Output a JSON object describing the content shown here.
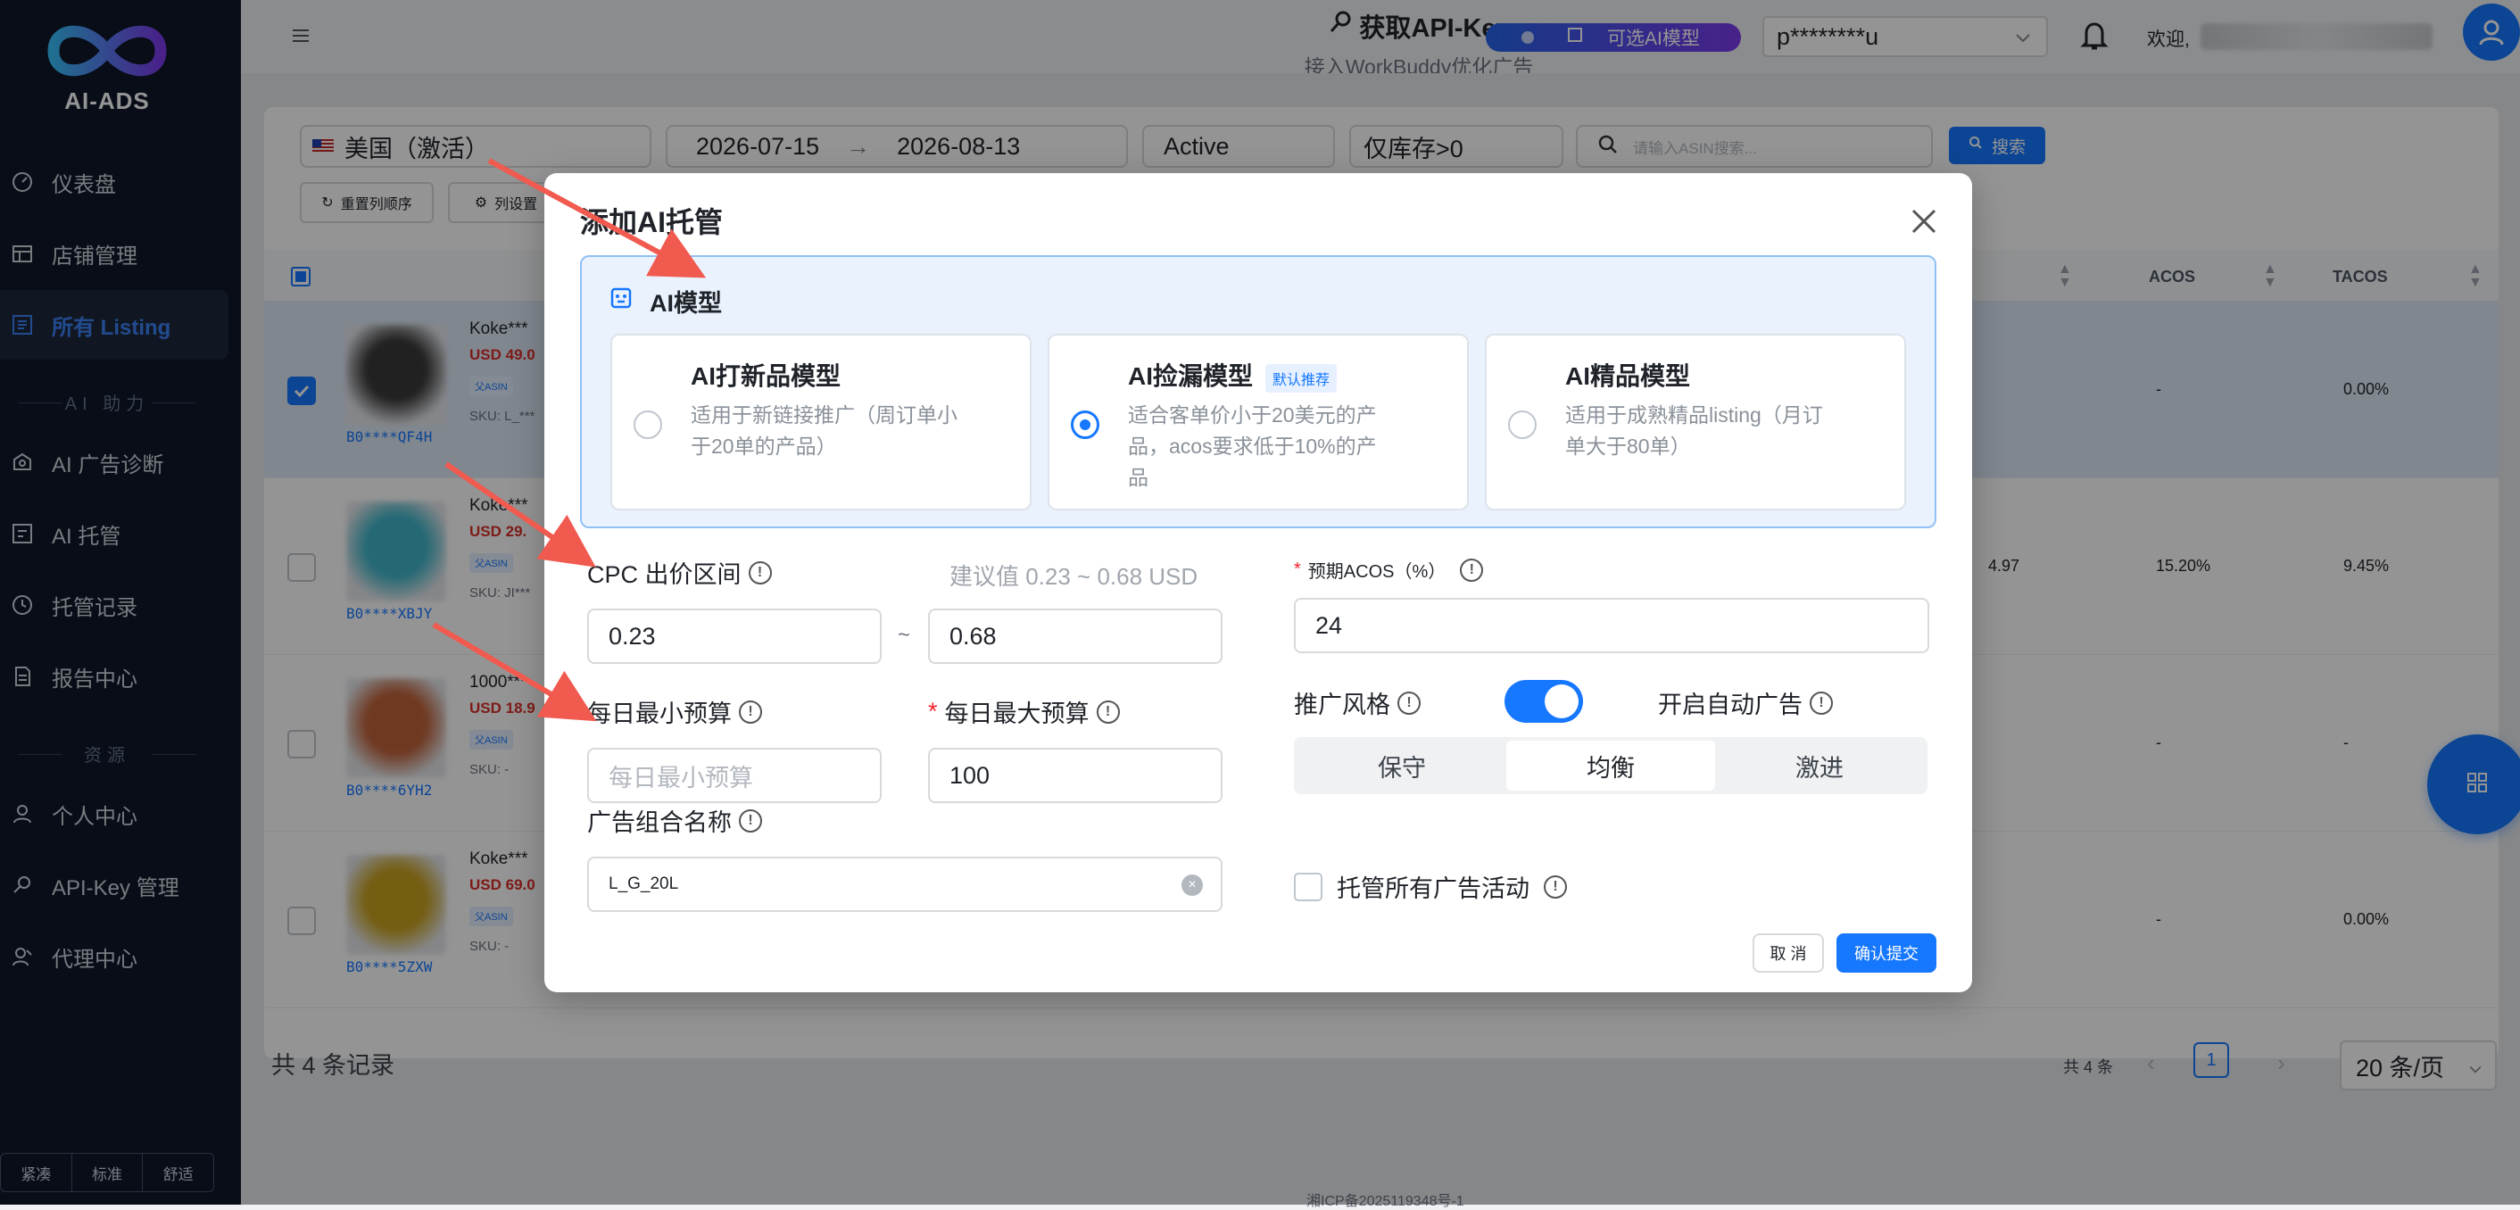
{
  "sidebar": {
    "logo_text": "AI-ADS",
    "items": [
      {
        "label": "仪表盘",
        "icon": "dashboard-icon"
      },
      {
        "label": "店铺管理",
        "icon": "store-icon"
      },
      {
        "label": "所有 Listing",
        "icon": "list-icon",
        "active": true
      },
      {
        "label": "AI 广告诊断",
        "icon": "diagnosis-icon"
      },
      {
        "label": "AI 托管",
        "icon": "managed-icon"
      },
      {
        "label": "托管记录",
        "icon": "history-icon"
      },
      {
        "label": "报告中心",
        "icon": "report-icon"
      },
      {
        "label": "个人中心",
        "icon": "user-icon"
      },
      {
        "label": "API-Key 管理",
        "icon": "key-icon"
      },
      {
        "label": "代理中心",
        "icon": "agent-icon"
      }
    ],
    "sections": {
      "ai_help": "AI 助力",
      "resources": "资源"
    },
    "density": [
      "紧凑",
      "标准",
      "舒适"
    ]
  },
  "header": {
    "title": "获取API-Key",
    "subtitle": "接入WorkBuddy优化广告",
    "ai_model_pill": "可选AI模型",
    "account_select": "p********u",
    "welcome": "欢迎,"
  },
  "filters": {
    "marketplace": "美国（激活）",
    "date_start": "2026-07-15",
    "date_end": "2026-08-13",
    "status": "Active",
    "stock": "仅库存>0",
    "search_placeholder": "请输入ASIN搜索...",
    "search_button": "搜索",
    "reset_order": "重置列顺序",
    "column_settings": "列设置"
  },
  "table": {
    "headers": {
      "acos": "ACOS",
      "tacos": "TACOS"
    },
    "rows": [
      {
        "name": "Koke***",
        "price": "USD 49.0",
        "asin": "B0****QF4H",
        "sku": "SKU: L_***",
        "extra": "",
        "acos": "-",
        "tacos": "0.00%",
        "checked": true,
        "thumb": "#3a3a3a"
      },
      {
        "name": "Koke***",
        "price": "USD 29.",
        "asin": "B0****XBJY",
        "sku": "SKU: JI***",
        "extra": "4.97",
        "acos": "15.20%",
        "tacos": "9.45%",
        "checked": false,
        "thumb": "#3fb5c9"
      },
      {
        "name": "1000***",
        "price": "USD 18.9",
        "asin": "B0****6YH2",
        "sku": "SKU: -",
        "extra": "",
        "acos": "-",
        "tacos": "-",
        "checked": false,
        "thumb": "#c0623a"
      },
      {
        "name": "Koke***",
        "price": "USD 69.0",
        "asin": "B0****5ZXW",
        "sku": "SKU: -",
        "extra": "",
        "acos": "-",
        "tacos": "0.00%",
        "checked": false,
        "thumb": "#c9a21f"
      }
    ],
    "asin_tag": "父ASIN",
    "total_records": "共 4 条记录",
    "pager_total": "共 4 条",
    "page": "1",
    "page_size": "20 条/页"
  },
  "footer_text": "湘ICP备2025119348号-1",
  "modal": {
    "title": "添加AI托管",
    "model_section": "AI模型",
    "models": [
      {
        "title": "AI打新品模型",
        "desc": "适用于新链接推广（周订单小于20单的产品）",
        "selected": false
      },
      {
        "title": "AI捡漏模型",
        "badge": "默认推荐",
        "desc": "适合客单价小于20美元的产品，acos要求低于10%的产品",
        "selected": true
      },
      {
        "title": "AI精品模型",
        "desc": "适用于成熟精品listing（月订单大于80单）",
        "selected": false
      }
    ],
    "cpc_label": "CPC 出价区间",
    "cpc_hint": "建议值 0.23 ~ 0.68 USD",
    "cpc_min": "0.23",
    "cpc_sep": "~",
    "cpc_max": "0.68",
    "acos_label": "预期ACOS（%）",
    "acos_value": "24",
    "min_budget_label": "每日最小预算",
    "min_budget_placeholder": "每日最小预算",
    "max_budget_label": "每日最大预算",
    "max_budget_value": "100",
    "style_label": "推广风格",
    "auto_ad_label": "开启自动广告",
    "style_options": [
      "保守",
      "均衡",
      "激进"
    ],
    "style_selected": 1,
    "adgroup_label": "广告组合名称",
    "adgroup_value": "L_G_20L",
    "manage_all_label": "托管所有广告活动",
    "cancel": "取 消",
    "submit": "确认提交"
  },
  "colors": {
    "primary": "#1677ff",
    "sidebar": "#0f172a",
    "danger": "#f5222d",
    "arrow": "#f05a4f"
  }
}
